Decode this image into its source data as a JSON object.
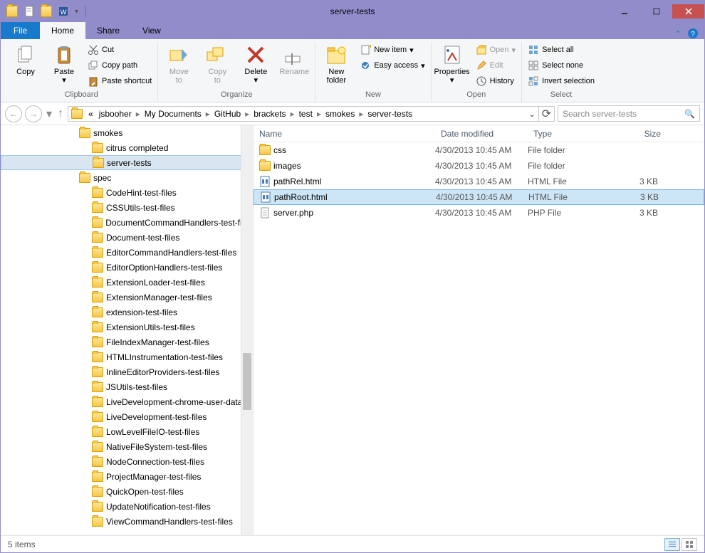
{
  "window": {
    "title": "server-tests"
  },
  "tabs": {
    "file": "File",
    "home": "Home",
    "share": "Share",
    "view": "View"
  },
  "ribbon": {
    "clipboard": {
      "copy": "Copy",
      "paste": "Paste",
      "cut": "Cut",
      "copypath": "Copy path",
      "pasteshortcut": "Paste shortcut",
      "label": "Clipboard"
    },
    "organize": {
      "moveto": "Move\nto",
      "copyto": "Copy\nto",
      "delete": "Delete",
      "rename": "Rename",
      "label": "Organize"
    },
    "new": {
      "newfolder": "New\nfolder",
      "newitem": "New item",
      "easyaccess": "Easy access",
      "label": "New"
    },
    "open": {
      "properties": "Properties",
      "open": "Open",
      "edit": "Edit",
      "history": "History",
      "label": "Open"
    },
    "select": {
      "selectall": "Select all",
      "selectnone": "Select none",
      "invert": "Invert selection",
      "label": "Select"
    }
  },
  "breadcrumb": {
    "parts": [
      "jsbooher",
      "My Documents",
      "GitHub",
      "brackets",
      "test",
      "smokes",
      "server-tests"
    ],
    "ellipsis": "«"
  },
  "search": {
    "placeholder": "Search server-tests"
  },
  "tree": {
    "items": [
      {
        "label": "smokes",
        "indent": 0
      },
      {
        "label": "citrus completed",
        "indent": 1
      },
      {
        "label": "server-tests",
        "indent": 1,
        "selected": true
      },
      {
        "label": "spec",
        "indent": 0
      },
      {
        "label": "CodeHint-test-files",
        "indent": 1
      },
      {
        "label": "CSSUtils-test-files",
        "indent": 1
      },
      {
        "label": "DocumentCommandHandlers-test-files",
        "indent": 1
      },
      {
        "label": "Document-test-files",
        "indent": 1
      },
      {
        "label": "EditorCommandHandlers-test-files",
        "indent": 1
      },
      {
        "label": "EditorOptionHandlers-test-files",
        "indent": 1
      },
      {
        "label": "ExtensionLoader-test-files",
        "indent": 1
      },
      {
        "label": "ExtensionManager-test-files",
        "indent": 1
      },
      {
        "label": "extension-test-files",
        "indent": 1
      },
      {
        "label": "ExtensionUtils-test-files",
        "indent": 1
      },
      {
        "label": "FileIndexManager-test-files",
        "indent": 1
      },
      {
        "label": "HTMLInstrumentation-test-files",
        "indent": 1
      },
      {
        "label": "InlineEditorProviders-test-files",
        "indent": 1
      },
      {
        "label": "JSUtils-test-files",
        "indent": 1
      },
      {
        "label": "LiveDevelopment-chrome-user-data",
        "indent": 1
      },
      {
        "label": "LiveDevelopment-test-files",
        "indent": 1
      },
      {
        "label": "LowLevelFileIO-test-files",
        "indent": 1
      },
      {
        "label": "NativeFileSystem-test-files",
        "indent": 1
      },
      {
        "label": "NodeConnection-test-files",
        "indent": 1
      },
      {
        "label": "ProjectManager-test-files",
        "indent": 1
      },
      {
        "label": "QuickOpen-test-files",
        "indent": 1
      },
      {
        "label": "UpdateNotification-test-files",
        "indent": 1
      },
      {
        "label": "ViewCommandHandlers-test-files",
        "indent": 1
      }
    ]
  },
  "columns": {
    "name": "Name",
    "date": "Date modified",
    "type": "Type",
    "size": "Size"
  },
  "files": [
    {
      "name": "css",
      "date": "4/30/2013 10:45 AM",
      "type": "File folder",
      "size": "",
      "icon": "folder"
    },
    {
      "name": "images",
      "date": "4/30/2013 10:45 AM",
      "type": "File folder",
      "size": "",
      "icon": "folder"
    },
    {
      "name": "pathRel.html",
      "date": "4/30/2013 10:45 AM",
      "type": "HTML File",
      "size": "3 KB",
      "icon": "html"
    },
    {
      "name": "pathRoot.html",
      "date": "4/30/2013 10:45 AM",
      "type": "HTML File",
      "size": "3 KB",
      "icon": "html",
      "selected": true
    },
    {
      "name": "server.php",
      "date": "4/30/2013 10:45 AM",
      "type": "PHP File",
      "size": "3 KB",
      "icon": "php"
    }
  ],
  "status": {
    "count": "5 items"
  }
}
